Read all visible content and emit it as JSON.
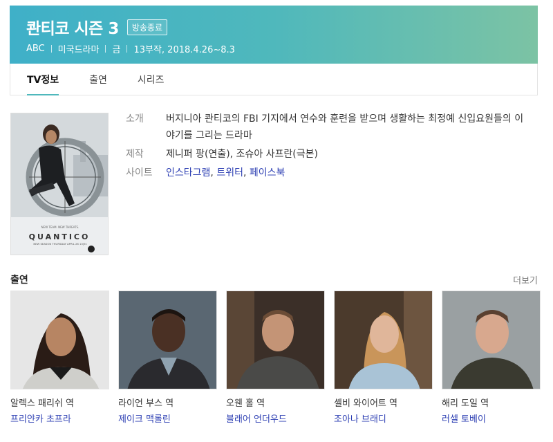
{
  "show": {
    "title": "콴티코 시즌 3",
    "status_badge": "방송종료",
    "meta": [
      "ABC",
      "미국드라마",
      "금",
      "13부작, 2018.4.26~8.3"
    ]
  },
  "tabs": [
    {
      "label": "TV정보",
      "active": true
    },
    {
      "label": "출연",
      "active": false
    },
    {
      "label": "시리즈",
      "active": false
    }
  ],
  "poster": {
    "logo_text": "QUANTICO"
  },
  "info": {
    "intro_label": "소개",
    "intro_text": "버지니아 콴티코의 FBI 기지에서 연수와 훈련을 받으며 생활하는 최정예 신입요원들의 이야기를 그리는 드라마",
    "production_label": "제작",
    "production_text": "제니퍼 팡(연출), 조슈아 사프란(극본)",
    "site_label": "사이트",
    "sites": [
      "인스타그램",
      "트위터",
      "페이스북"
    ]
  },
  "cast_section": {
    "title": "출연",
    "more_label": "더보기",
    "members": [
      {
        "role": "알렉스 패리쉬 역",
        "actor": "프리얀카 초프라"
      },
      {
        "role": "라이언 부스 역",
        "actor": "제이크 맥롤린"
      },
      {
        "role": "오웬 홀 역",
        "actor": "블래어 언더우드"
      },
      {
        "role": "셸비 와이어트 역",
        "actor": "조아나 브래디"
      },
      {
        "role": "해리 도일 역",
        "actor": "러셀 토베이"
      }
    ]
  },
  "colors": {
    "header_start": "#3fb0c8",
    "header_end": "#7cc3a4",
    "link": "#2d3fb3",
    "tab_underline": "#4fb8bc"
  }
}
